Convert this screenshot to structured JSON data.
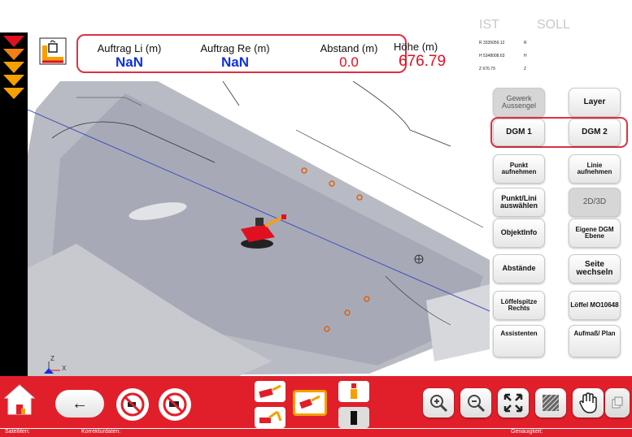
{
  "header": {
    "auftrag_li_label": "Auftrag Li (m)",
    "auftrag_li_value": "NaN",
    "auftrag_re_label": "Auftrag Re (m)",
    "auftrag_re_value": "NaN",
    "abstand_label": "Abstand (m)",
    "abstand_value": "0.0",
    "hoehe_label": "Höhe (m)",
    "hoehe_value": "676.79"
  },
  "coords": {
    "ist_label": "IST",
    "soll_label": "SOLL",
    "r_ist": "R 3335059.12",
    "r_soll": "R",
    "h_ist": "H 5348008.63",
    "h_soll": "H",
    "z_ist": "Z 676.79",
    "z_soll": "Z"
  },
  "panel": {
    "gewerk": "Gewerk Aussengel",
    "layer": "Layer",
    "dgm1": "DGM 1",
    "dgm2": "DGM 2",
    "punkt_aufnehmen": "Punkt aufnehmen",
    "linie_aufnehmen": "Linie aufnehmen",
    "punkt_lini_auswaehlen": "Punkt/Lini auswählen",
    "toggle_2d3d": "2D/3D",
    "objektinfo": "ObjektInfo",
    "eigene_dgm": "Eigene DGM Ebene",
    "abstaende": "Abstände",
    "seite_wechseln": "Seite wechseln",
    "loeffelspitze": "Löffelspitze Rechts",
    "loeffel": "Löffel MO10648",
    "assistenten": "Assistenten",
    "aufmass_plan": "Aufmaß/ Plan"
  },
  "axis": {
    "z": "Z",
    "x": "X"
  },
  "status": {
    "satelliten": "Satelliten:",
    "korrekturdaten": "Korrekturdaten:",
    "genauigkeit": "Genauigkeit:"
  },
  "icons": {
    "home": "home-icon",
    "back": "arrow-left-icon",
    "no_sound_1": "prohibited-icon",
    "no_sound_2": "prohibited-icon",
    "zoom_in": "zoom-in-icon",
    "zoom_out": "zoom-out-icon",
    "fit": "fit-extent-icon",
    "hatch": "hatch-icon",
    "hand": "hand-pan-icon",
    "copy": "copy-icon"
  },
  "colors": {
    "accent": "#e01f2a",
    "blue_value": "#1030e0",
    "red_value": "#e01020",
    "warning_chevron": "#f5a000"
  }
}
